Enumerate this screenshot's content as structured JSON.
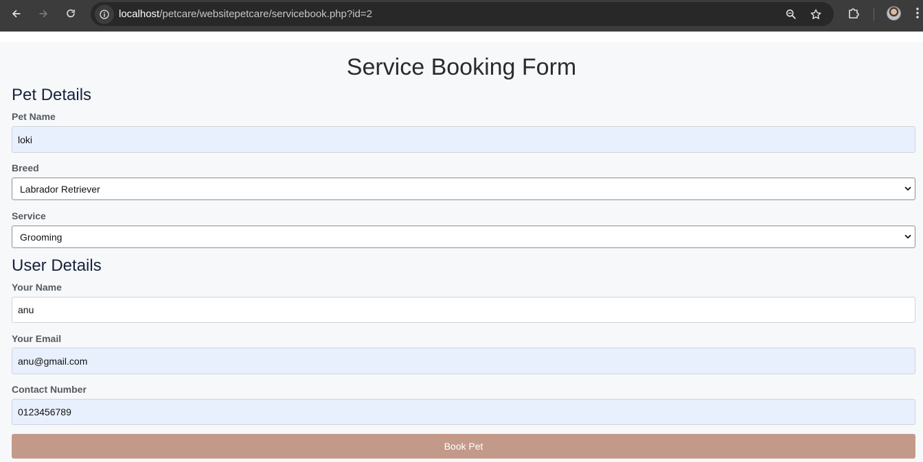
{
  "browser": {
    "url_host": "localhost",
    "url_path": "/petcare/websitepetcare/servicebook.php?id=2",
    "icons": [
      "back-icon",
      "forward-icon",
      "reload-icon",
      "site-info-icon",
      "zoom-icon",
      "bookmark-star-icon",
      "extensions-icon",
      "menu-icon"
    ]
  },
  "page": {
    "title": "Service Booking Form",
    "pet_section": {
      "title": "Pet Details",
      "pet_name_label": "Pet Name",
      "pet_name_value": "loki",
      "breed_label": "Breed",
      "breed_value": "Labrador Retriever",
      "service_label": "Service",
      "service_value": "Grooming"
    },
    "user_section": {
      "title": "User Details",
      "name_label": "Your Name",
      "name_value": "anu",
      "email_label": "Your Email",
      "email_value": "anu@gmail.com",
      "contact_label": "Contact Number",
      "contact_value": "0123456789"
    },
    "submit_label": "Book Pet"
  },
  "colors": {
    "chrome_bar": "#3c3c3c",
    "page_bg": "#f6f8fa",
    "autofill_bg": "#e8f0fe",
    "button_bg": "#c39a8a"
  }
}
